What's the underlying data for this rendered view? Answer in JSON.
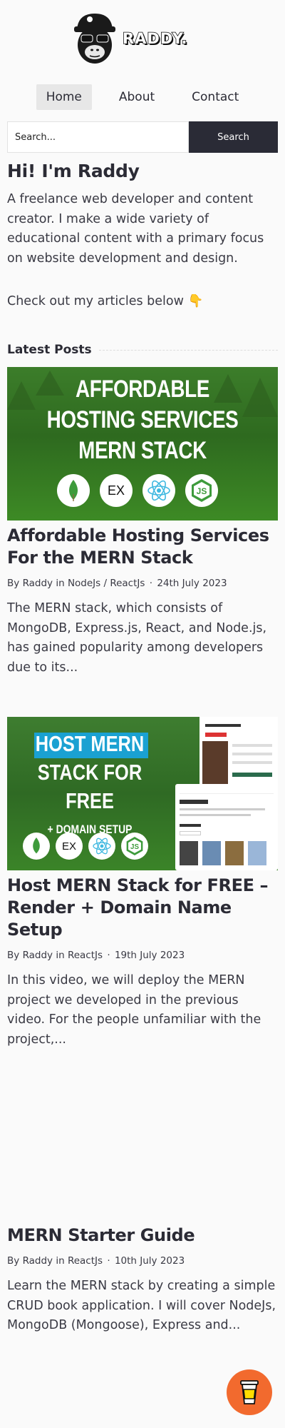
{
  "brand": {
    "logo_text": "RADDY."
  },
  "nav": {
    "items": [
      {
        "label": "Home",
        "active": true
      },
      {
        "label": "About",
        "active": false
      },
      {
        "label": "Contact",
        "active": false
      }
    ]
  },
  "search": {
    "placeholder": "Search...",
    "button_label": "Search"
  },
  "intro": {
    "title": "Hi! I'm Raddy",
    "bio": "A freelance web developer and content creator. I make a wide variety of educational content with a primary focus on website development and design.",
    "cta": "Check out my articles below 👇"
  },
  "latest": {
    "heading": "Latest Posts"
  },
  "posts": [
    {
      "thumb_lines": [
        "AFFORDABLE",
        "HOSTING SERVICES",
        "MERN STACK"
      ],
      "title": "Affordable Hosting Services For the MERN Stack",
      "author": "Raddy",
      "categories": "NodeJs / ReactJs",
      "date": "24th July 2023",
      "excerpt": "The MERN stack, which consists of MongoDB, Express.js, React, and Node.js, has gained popularity among developers due to its..."
    },
    {
      "thumb_lines": [
        "HOST MERN",
        "STACK FOR FREE",
        "+ DOMAIN SETUP"
      ],
      "title": "Host MERN Stack for FREE – Render + Domain Name Setup",
      "author": "Raddy",
      "categories": "ReactJs",
      "date": "19th July 2023",
      "excerpt": "In this video, we will deploy the MERN project we developed in the previous video. For the people unfamiliar with the project,..."
    },
    {
      "title": "MERN Starter Guide",
      "author": "Raddy",
      "categories": "ReactJs",
      "date": "10th July 2023",
      "excerpt": "Learn the MERN stack by creating a simple CRUD book application. I will cover NodeJs, MongoDB (Mongoose), Express and..."
    }
  ],
  "thumb_icons": {
    "ex": "EX",
    "js": "JS"
  },
  "meta_words": {
    "by": "By",
    "in": "in",
    "sep": "·"
  },
  "colors": {
    "accent_dark": "#2a2b36",
    "coffee_button": "#f26a2e",
    "thumb_green": "#2e6a1f"
  }
}
